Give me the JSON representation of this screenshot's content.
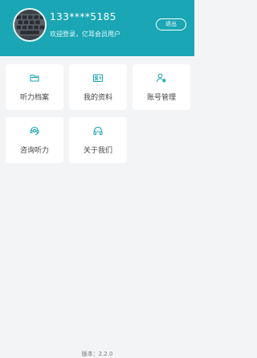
{
  "header": {
    "phone": "133****5185",
    "welcome": "欢迎登录，亿耳会员用户",
    "logout_label": "退出"
  },
  "menu": {
    "items": [
      {
        "label": "听力档案",
        "icon": "folder-icon"
      },
      {
        "label": "我的资料",
        "icon": "profile-card-icon"
      },
      {
        "label": "账号管理",
        "icon": "user-settings-icon"
      },
      {
        "label": "咨询听力",
        "icon": "headset-support-icon"
      },
      {
        "label": "关于我们",
        "icon": "headphones-icon"
      }
    ]
  },
  "footer": {
    "version": "版本：2.2.0"
  },
  "colors": {
    "header_bg": "#1aa6b4",
    "page_bg": "#f3f4f6",
    "card_bg": "#ffffff"
  }
}
